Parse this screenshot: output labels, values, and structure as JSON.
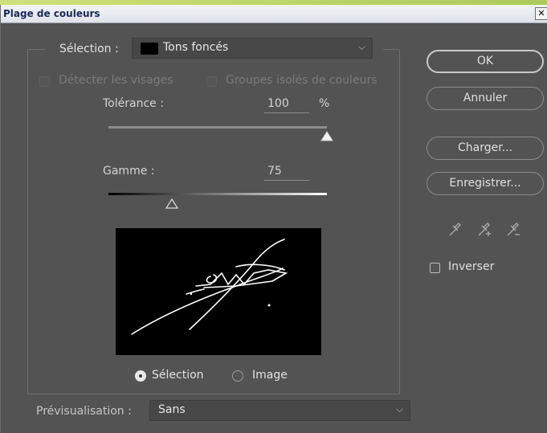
{
  "window": {
    "title": "Plage de couleurs",
    "close_glyph": "✕"
  },
  "selection": {
    "label": "Sélection :",
    "value": "Tons foncés",
    "swatch_color": "#000000"
  },
  "options": {
    "detect_faces": {
      "label": "Détecter les visages",
      "checked": false,
      "enabled": false
    },
    "localized_clusters": {
      "label": "Groupes isolés de couleurs",
      "checked": false,
      "enabled": false
    }
  },
  "tolerance": {
    "label": "Tolérance :",
    "value": "100",
    "unit": "%",
    "level": 1.0
  },
  "range": {
    "label": "Gamme :",
    "value": "75",
    "level": 0.29
  },
  "view_mode": {
    "options": [
      {
        "label": "Sélection",
        "selected": true
      },
      {
        "label": "Image",
        "selected": false
      }
    ]
  },
  "buttons": {
    "ok": "OK",
    "cancel": "Annuler",
    "load": "Charger...",
    "save": "Enregistrer..."
  },
  "eyedroppers": [
    "eyedropper-icon",
    "eyedropper-add-icon",
    "eyedropper-subtract-icon"
  ],
  "invert": {
    "label": "Inverser",
    "checked": false
  },
  "preview_mode": {
    "label": "Prévisualisation :",
    "value": "Sans"
  },
  "colors": {
    "panel": "#535353",
    "text": "#d3d3d3",
    "titlebar_text": "#1b2a55"
  }
}
